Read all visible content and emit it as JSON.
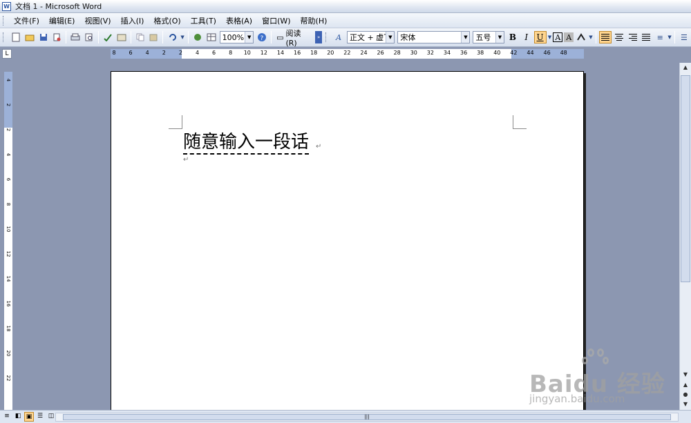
{
  "window": {
    "title": "文档 1 - Microsoft Word",
    "app_icon": "W"
  },
  "menu": [
    "文件(F)",
    "编辑(E)",
    "视图(V)",
    "插入(I)",
    "格式(O)",
    "工具(T)",
    "表格(A)",
    "窗口(W)",
    "帮助(H)"
  ],
  "toolbar": {
    "zoom": "100%",
    "read_label": "阅读(R)",
    "style": "正文 + 虚下",
    "font": "宋体",
    "size": "五号",
    "bold": "B",
    "italic": "I",
    "underline": "U",
    "char_border": "A",
    "char_shading": "A"
  },
  "ruler": {
    "corner": "L",
    "h_labels": [
      "8",
      "6",
      "4",
      "2",
      "2",
      "4",
      "6",
      "8",
      "10",
      "12",
      "14",
      "16",
      "18",
      "20",
      "22",
      "24",
      "26",
      "28",
      "30",
      "32",
      "34",
      "36",
      "38",
      "40",
      "42",
      "44",
      "46",
      "48"
    ],
    "v_labels": [
      "4",
      "2",
      "2",
      "4",
      "6",
      "8",
      "10",
      "12",
      "14",
      "16",
      "18",
      "20",
      "22"
    ]
  },
  "document": {
    "text": "随意输入一段话",
    "para_mark": "↵"
  },
  "watermark": {
    "brand": "Baidu 经验",
    "url": "jingyan.baidu.com"
  }
}
